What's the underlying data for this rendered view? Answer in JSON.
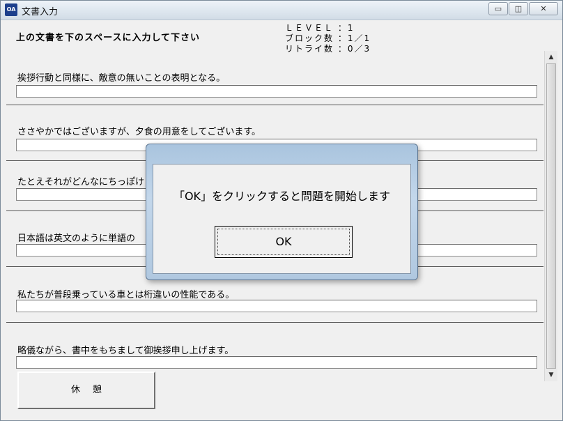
{
  "window": {
    "app_icon_text": "OA",
    "title": "文書入力",
    "controls": {
      "minimize": "▭",
      "maximize": "◫",
      "close": "✕"
    }
  },
  "instruction": "上の文書を下のスペースに入力して下さい",
  "status": {
    "level": "ＬＥＶＥＬ ：1",
    "blocks": "ブロック数 ：1／1",
    "retries": "リトライ数 ：0／3"
  },
  "blocks": [
    {
      "prompt": "挨拶行動と同様に、敵意の無いことの表明となる。",
      "answer": ""
    },
    {
      "prompt": "ささやかではございますが、夕食の用意をしてございます。",
      "answer": ""
    },
    {
      "prompt": "たとえそれがどんなにちっぽけ",
      "answer": ""
    },
    {
      "prompt": "日本語は英文のように単語の",
      "answer": ""
    },
    {
      "prompt": "私たちが普段乗っている車とは桁違いの性能である。",
      "answer": ""
    },
    {
      "prompt": "略儀ながら、書中をもちまして御挨拶申し上げます。",
      "answer": ""
    }
  ],
  "scrollbar": {
    "up_arrow": "▲",
    "down_arrow": "▼"
  },
  "rest_button": "休憩",
  "dialog": {
    "message": "「OK」をクリックすると問題を開始します",
    "ok_button": "OK"
  }
}
